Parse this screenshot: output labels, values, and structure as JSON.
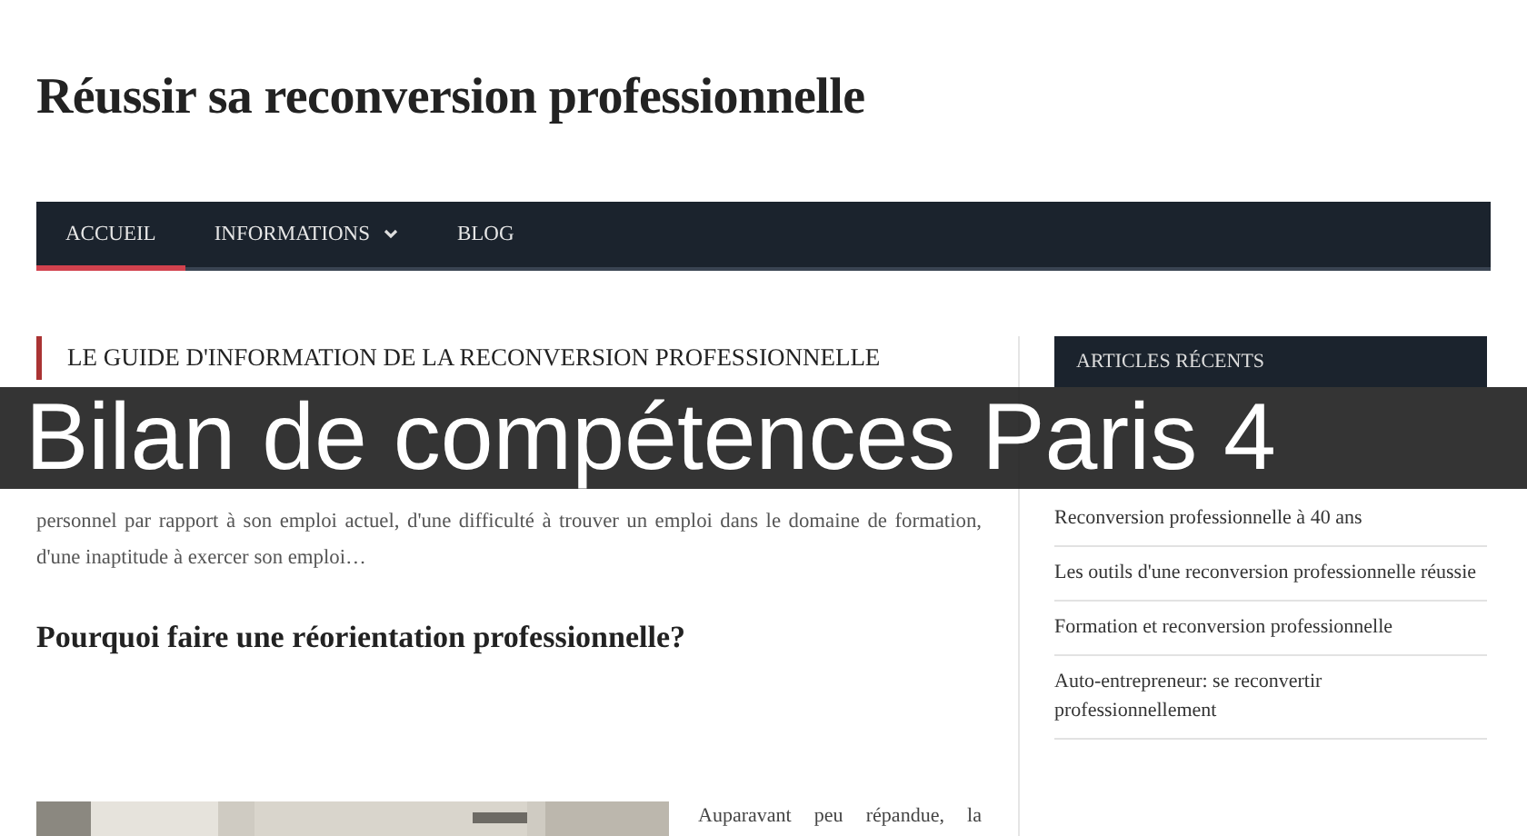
{
  "site_title": "Réussir sa reconversion professionnelle",
  "nav": [
    {
      "label": "ACCUEIL",
      "selected": true,
      "dropdown": false
    },
    {
      "label": "INFORMATIONS",
      "selected": false,
      "dropdown": true
    },
    {
      "label": "BLOG",
      "selected": false,
      "dropdown": false
    }
  ],
  "main": {
    "section_title": "LE GUIDE D'INFORMATION DE LA RECONVERSION PROFESSIONNELLE",
    "intro": "personnel par rapport à son emploi actuel, d'une difficulté à trouver un emploi dans le domaine de formation, d'une inaptitude à exercer son emploi…",
    "article_title": "Pourquoi faire une réorientation professionnelle?",
    "article_text": "Auparavant peu répandue, la"
  },
  "sidebar": {
    "title": "ARTICLES RÉCENTS",
    "items": [
      "Reconversion professionnelle à 40 ans",
      "Les outils d'une reconversion professionnelle réussie",
      "Formation et reconversion professionnelle",
      "Auto-entrepreneur: se reconvertir professionnellement"
    ]
  },
  "banner": "Bilan de compétences Paris 4"
}
